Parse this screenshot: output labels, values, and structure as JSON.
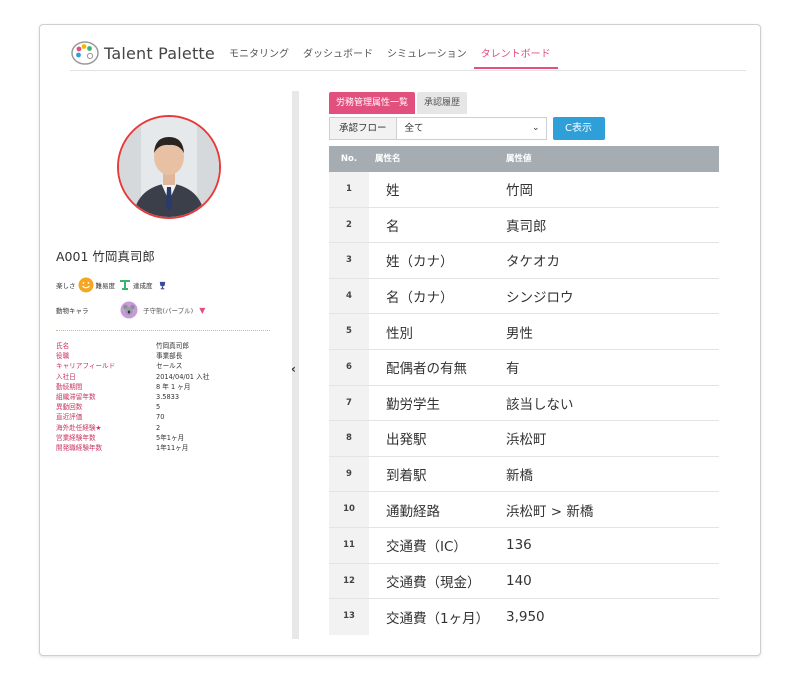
{
  "app": {
    "logo_text": "Talent Palette"
  },
  "nav": [
    {
      "label": "モニタリング"
    },
    {
      "label": "ダッシュボード"
    },
    {
      "label": "シミュレーション"
    },
    {
      "label": "タレントボード"
    }
  ],
  "profile": {
    "name": "A001 竹岡真司郎",
    "mood_labels": {
      "fun": "楽しさ",
      "difficulty": "難易度",
      "achievement": "達成度"
    },
    "animal_label": "動物キャラ",
    "animal_value": "子守熊(パープル)",
    "info": [
      {
        "key": "氏名",
        "value": "竹岡真司郎"
      },
      {
        "key": "役職",
        "value": "事業部長"
      },
      {
        "key": "キャリアフィールド",
        "value": "セールス"
      },
      {
        "key": "入社日",
        "value": "2014/04/01 入社"
      },
      {
        "key": "勤続期間",
        "value": "8 年 1 ヶ月"
      },
      {
        "key": "組織滞留年数",
        "value": "3.5833"
      },
      {
        "key": "異動回数",
        "value": "5"
      },
      {
        "key": "直近評価",
        "value": "70"
      },
      {
        "key": "海外赴任経験★",
        "value": "2"
      },
      {
        "key": "営業経験年数",
        "value": "5年1ヶ月"
      },
      {
        "key": "開発職経験年数",
        "value": "1年11ヶ月"
      }
    ]
  },
  "tabs": [
    {
      "label": "労務管理属性一覧"
    },
    {
      "label": "承認履歴"
    }
  ],
  "filter": {
    "label": "承認フロー",
    "selected": "全て",
    "button_label": "C表示"
  },
  "table": {
    "headers": {
      "no": "No.",
      "name": "属性名",
      "value": "属性値"
    },
    "rows": [
      {
        "no": "1",
        "name": "姓",
        "value": "竹岡"
      },
      {
        "no": "2",
        "name": "名",
        "value": "真司郎"
      },
      {
        "no": "3",
        "name": "姓（カナ）",
        "value": "タケオカ"
      },
      {
        "no": "4",
        "name": "名（カナ）",
        "value": "シンジロウ"
      },
      {
        "no": "5",
        "name": "性別",
        "value": "男性"
      },
      {
        "no": "6",
        "name": "配偶者の有無",
        "value": "有"
      },
      {
        "no": "7",
        "name": "勤労学生",
        "value": "該当しない"
      },
      {
        "no": "8",
        "name": "出発駅",
        "value": "浜松町"
      },
      {
        "no": "9",
        "name": "到着駅",
        "value": "新橋"
      },
      {
        "no": "10",
        "name": "通勤経路",
        "value": "浜松町 > 新橋"
      },
      {
        "no": "11",
        "name": "交通費（IC）",
        "value": "136"
      },
      {
        "no": "12",
        "name": "交通費（現金）",
        "value": "140"
      },
      {
        "no": "13",
        "name": "交通費（1ヶ月）",
        "value": "3,950"
      }
    ]
  },
  "colors": {
    "accent": "#e2517d",
    "button": "#2e9fd8",
    "header_bg": "#a5adb3"
  }
}
